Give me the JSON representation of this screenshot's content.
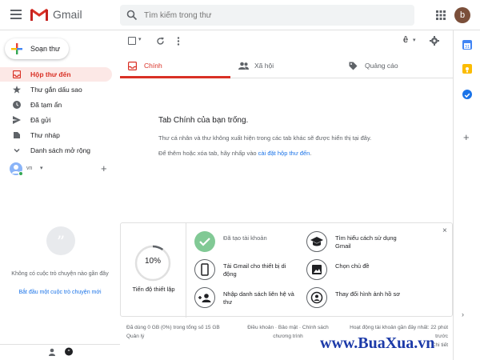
{
  "app": {
    "name": "Gmail"
  },
  "search": {
    "placeholder": "Tìm kiếm trong thư"
  },
  "account": {
    "initial": "b"
  },
  "compose": {
    "label": "Soạn thư"
  },
  "nav": {
    "items": [
      {
        "label": "Hộp thư đến",
        "icon": "inbox-icon",
        "active": true
      },
      {
        "label": "Thư gắn dấu sao",
        "icon": "star-icon"
      },
      {
        "label": "Đã tạm ẩn",
        "icon": "clock-icon"
      },
      {
        "label": "Đã gửi",
        "icon": "send-icon"
      },
      {
        "label": "Thư nháp",
        "icon": "draft-icon"
      },
      {
        "label": "Danh sách mở rộng",
        "icon": "chevron-down-icon"
      }
    ]
  },
  "hangouts": {
    "user": "vn",
    "no_chats": "Không có cuộc trò chuyện nào gần đây",
    "start_link": "Bắt đầu một cuộc trò chuyện mới"
  },
  "toolbar": {
    "input_tool": "ê"
  },
  "tabs": [
    {
      "label": "Chính",
      "icon": "inbox-tab-icon",
      "active": true
    },
    {
      "label": "Xã hội",
      "icon": "people-icon"
    },
    {
      "label": "Quảng cáo",
      "icon": "tag-icon"
    }
  ],
  "empty": {
    "title": "Tab Chính của bạn trống.",
    "line1": "Thư cá nhân và thư không xuất hiện trong các tab khác sẽ được hiển thị tại đây.",
    "line2_prefix": "Để thêm hoặc xóa tab, hãy nhấp vào ",
    "line2_link": "cài đặt hộp thư đến",
    "line2_suffix": "."
  },
  "setup": {
    "progress": 0.1,
    "progress_text": "10%",
    "label": "Tiến độ thiết lập",
    "tasks": [
      {
        "label": "Đã tạo tài khoản",
        "icon": "check-icon",
        "done": true
      },
      {
        "label": "Tìm hiểu cách sử dụng Gmail",
        "icon": "graduation-cap-icon"
      },
      {
        "label": "Tải Gmail cho thiết bị di động",
        "icon": "phone-icon"
      },
      {
        "label": "Chọn chủ đề",
        "icon": "image-icon"
      },
      {
        "label": "Nhập danh sách liên hệ và thư",
        "icon": "add-person-icon"
      },
      {
        "label": "Thay đổi hình ảnh hồ sơ",
        "icon": "profile-icon"
      }
    ]
  },
  "footer": {
    "storage": "Đã dùng 0 GB (0%) trong tổng số 15 GB",
    "manage": "Quản lý",
    "links": "Điều khoản · Bảo mật · Chính sách chương trình",
    "activity": "Hoạt động tài khoản gần đây nhất: 22 phút trước",
    "details": "Chi tiết"
  },
  "watermark": "www.BuaXua.vn",
  "colors": {
    "accent": "#d93025",
    "link": "#1a73e8",
    "done": "#81c995"
  }
}
